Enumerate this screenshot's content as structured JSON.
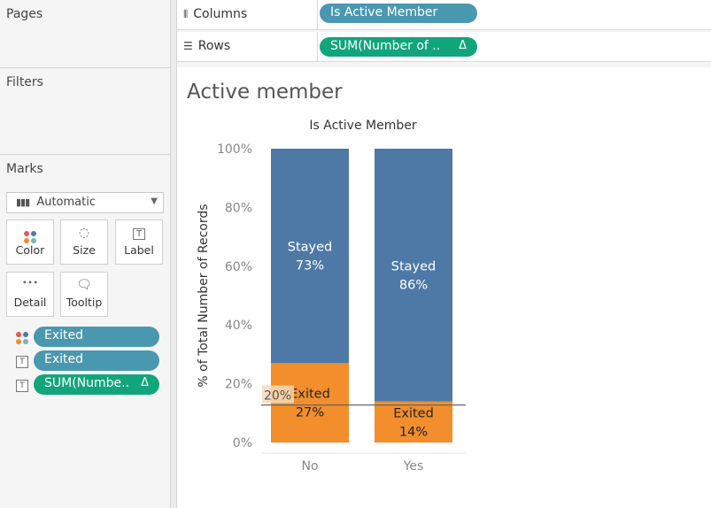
{
  "pages": {
    "title": "Pages"
  },
  "filters": {
    "title": "Filters"
  },
  "marks": {
    "title": "Marks",
    "mark_type": "Automatic",
    "buttons": [
      "Color",
      "Size",
      "Label",
      "Detail",
      "Tooltip"
    ],
    "fields": [
      {
        "label": "Exited",
        "kind": "color",
        "pill": "blue"
      },
      {
        "label": "Exited",
        "kind": "label",
        "pill": "blue"
      },
      {
        "label": "SUM(Numbe..",
        "kind": "label",
        "pill": "green",
        "delta": "Δ"
      }
    ]
  },
  "shelves": {
    "columns": {
      "label": "Columns",
      "pill": "Is Active Member"
    },
    "rows": {
      "label": "Rows",
      "pill": "SUM(Number of ..",
      "delta": "Δ"
    }
  },
  "sheet": {
    "title": "Active member"
  },
  "colors": {
    "stayed": "#4e79a7",
    "exited": "#f28e2b",
    "blue_pill": "#4a97b0",
    "green_pill": "#12a57c"
  },
  "chart_data": {
    "type": "bar",
    "stacked": true,
    "title": "Is Active Member",
    "xlabel": "",
    "ylabel": "% of Total Number of Records",
    "categories": [
      "No",
      "Yes"
    ],
    "series": [
      {
        "name": "Exited",
        "values": [
          27,
          14
        ],
        "labels": [
          "Exited\n27%",
          "Exited\n14%"
        ]
      },
      {
        "name": "Stayed",
        "values": [
          73,
          86
        ],
        "labels": [
          "Stayed\n73%",
          "Stayed\n86%"
        ]
      }
    ],
    "ylim": [
      0,
      100
    ],
    "yticks": [
      "0%",
      "20%",
      "40%",
      "60%",
      "80%",
      "100%"
    ],
    "reference_line": {
      "value": 20,
      "label": "20%"
    },
    "grid": false
  }
}
